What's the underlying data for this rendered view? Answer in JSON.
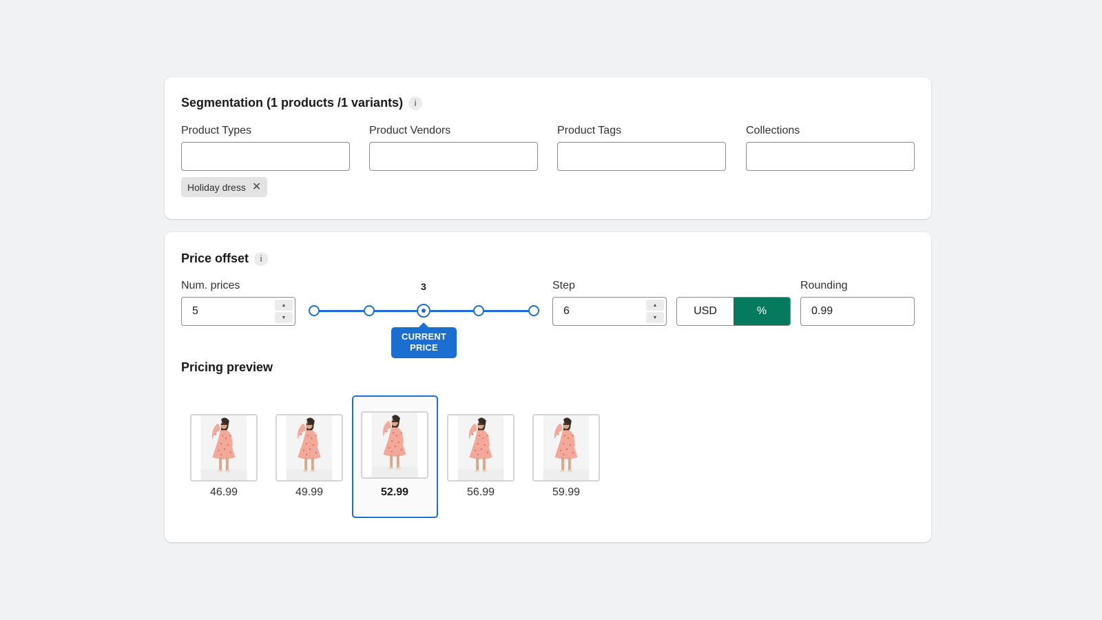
{
  "segmentation": {
    "title": "Segmentation (1 products /1 variants)",
    "info_icon": "info-icon",
    "fields": [
      {
        "label": "Product Types",
        "value": ""
      },
      {
        "label": "Product Vendors",
        "value": ""
      },
      {
        "label": "Product Tags",
        "value": ""
      },
      {
        "label": "Collections",
        "value": ""
      }
    ],
    "tag": {
      "label": "Holiday dress",
      "remove_icon": "close-icon"
    }
  },
  "price_offset": {
    "title": "Price offset",
    "info_icon": "info-icon",
    "num_prices": {
      "label": "Num. prices",
      "value": "5"
    },
    "slider": {
      "value": "3",
      "current_label": "CURRENT PRICE",
      "positions": 5,
      "selected_index": 2
    },
    "step": {
      "label": "Step",
      "value": "6"
    },
    "unit_toggle": {
      "options": [
        "USD",
        "%"
      ],
      "selected": "%"
    },
    "rounding": {
      "label": "Rounding",
      "value": "0.99"
    },
    "colors": {
      "accent": "#1c6fd1",
      "toggle_active": "#047b5d"
    }
  },
  "pricing_preview": {
    "title": "Pricing preview",
    "items": [
      {
        "price": "46.99",
        "image": "dress-image"
      },
      {
        "price": "49.99",
        "image": "dress-image"
      },
      {
        "price": "52.99",
        "image": "dress-image",
        "selected": true
      },
      {
        "price": "56.99",
        "image": "dress-image"
      },
      {
        "price": "59.99",
        "image": "dress-image"
      }
    ]
  }
}
